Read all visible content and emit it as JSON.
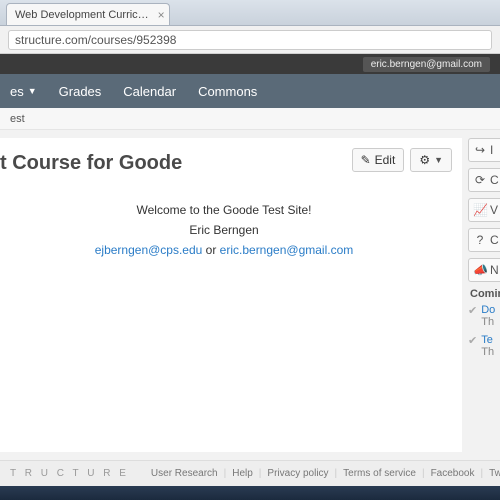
{
  "browser": {
    "tab_title": "Web Development Curric…",
    "url": "structure.com/courses/952398"
  },
  "topbar": {
    "user_email": "eric.berngen@gmail.com"
  },
  "nav": {
    "items": [
      {
        "label": "es",
        "has_dropdown": true
      },
      {
        "label": "Grades",
        "has_dropdown": false
      },
      {
        "label": "Calendar",
        "has_dropdown": false
      },
      {
        "label": "Commons",
        "has_dropdown": false
      }
    ]
  },
  "breadcrumb": {
    "text": "est"
  },
  "main": {
    "title": "t Course for Goode",
    "edit_label": "Edit",
    "welcome_line": "Welcome to the Goode Test Site!",
    "author": "Eric Berngen",
    "email1": "ejberngen@cps.edu",
    "or": " or ",
    "email2": "eric.berngen@gmail.com"
  },
  "sidebar": {
    "buttons": [
      {
        "icon": "↪",
        "label": "I"
      },
      {
        "icon": "⟳",
        "label": "C"
      },
      {
        "icon": "📈",
        "label": "V"
      },
      {
        "icon": "?",
        "label": "C"
      },
      {
        "icon": "📣",
        "label": "N"
      }
    ],
    "coming_up": "Comin",
    "feed": [
      {
        "icon": "✔",
        "title": "Do",
        "sub": "Th"
      },
      {
        "icon": "✔",
        "title": "Te",
        "sub": "Th"
      }
    ]
  },
  "footer": {
    "brand": "T R U C T U R E",
    "links": [
      "User Research",
      "Help",
      "Privacy policy",
      "Terms of service",
      "Facebook",
      "Twitter"
    ]
  }
}
